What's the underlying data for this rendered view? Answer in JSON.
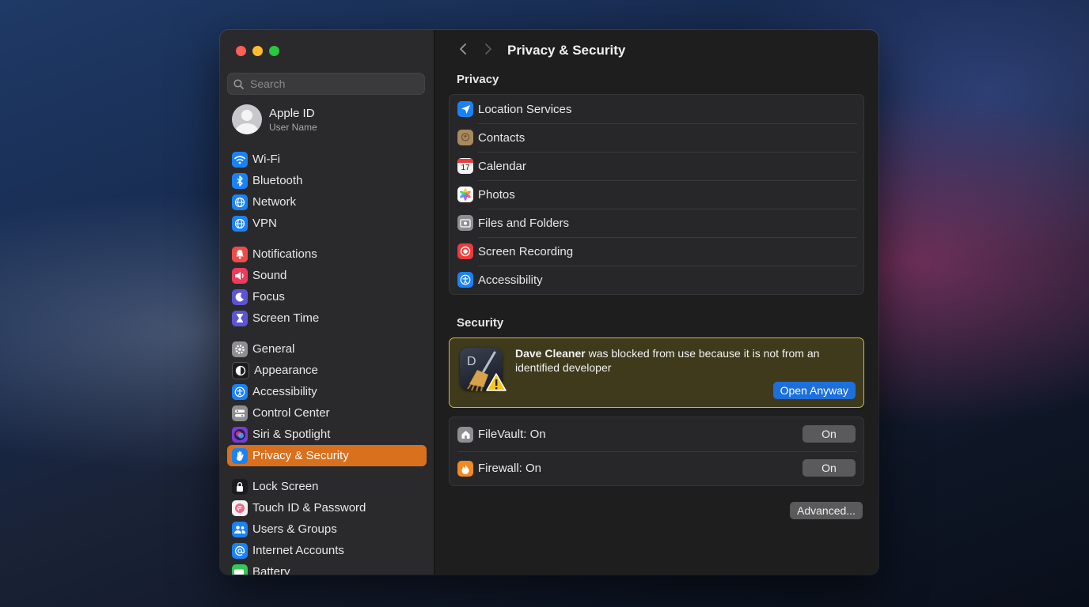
{
  "sidebar": {
    "search_placeholder": "Search",
    "apple_id": {
      "name": "Apple ID",
      "subtitle": "User Name"
    },
    "groups": [
      [
        {
          "label": "Wi-Fi",
          "icon": "wifi-icon",
          "color": "#1a82f7"
        },
        {
          "label": "Bluetooth",
          "icon": "bluetooth-icon",
          "color": "#1a82f7"
        },
        {
          "label": "Network",
          "icon": "globe-icon",
          "color": "#1a82f7"
        },
        {
          "label": "VPN",
          "icon": "globe-icon",
          "color": "#1a82f7"
        }
      ],
      [
        {
          "label": "Notifications",
          "icon": "bell-icon",
          "color": "#ee4b4b"
        },
        {
          "label": "Sound",
          "icon": "speaker-icon",
          "color": "#ee3b5b"
        },
        {
          "label": "Focus",
          "icon": "moon-icon",
          "color": "#5b55d6"
        },
        {
          "label": "Screen Time",
          "icon": "hourglass-icon",
          "color": "#5b55d6"
        }
      ],
      [
        {
          "label": "General",
          "icon": "gear-icon",
          "color": "#8e8e93"
        },
        {
          "label": "Appearance",
          "icon": "appearance-icon",
          "color": "#1c1c1e"
        },
        {
          "label": "Accessibility",
          "icon": "accessibility-icon",
          "color": "#1a82f7"
        },
        {
          "label": "Control Center",
          "icon": "switches-icon",
          "color": "#8e8e93"
        },
        {
          "label": "Siri & Spotlight",
          "icon": "siri-icon",
          "color": "#7a3bd6"
        },
        {
          "label": "Privacy & Security",
          "icon": "hand-icon",
          "color": "#1a82f7",
          "active": true
        }
      ],
      [
        {
          "label": "Lock Screen",
          "icon": "lock-icon",
          "color": "#1c1c1e"
        },
        {
          "label": "Touch ID & Password",
          "icon": "fingerprint-icon",
          "color": "#f2f2f2"
        },
        {
          "label": "Users & Groups",
          "icon": "users-icon",
          "color": "#1a82f7"
        },
        {
          "label": "Internet Accounts",
          "icon": "at-icon",
          "color": "#1a82f7"
        },
        {
          "label": "Battery",
          "icon": "battery-icon",
          "color": "#34c759"
        }
      ]
    ]
  },
  "main": {
    "title": "Privacy & Security",
    "privacy_heading": "Privacy",
    "privacy_items": [
      {
        "label": "Location Services",
        "icon": "location-arrow-icon",
        "color": "#1a82f7"
      },
      {
        "label": "Contacts",
        "icon": "contacts-icon",
        "color": "#a98a5e"
      },
      {
        "label": "Calendar",
        "icon": "calendar-icon",
        "color": "#f2f2f2",
        "glyph": "17"
      },
      {
        "label": "Photos",
        "icon": "photos-icon",
        "color": "#ffffff"
      },
      {
        "label": "Files and Folders",
        "icon": "folder-icon",
        "color": "#8e8e93"
      },
      {
        "label": "Screen Recording",
        "icon": "record-icon",
        "color": "#ee3b3b"
      },
      {
        "label": "Accessibility",
        "icon": "accessibility-icon",
        "color": "#1a82f7"
      }
    ],
    "security_heading": "Security",
    "alert": {
      "app_name": "Dave Cleaner",
      "message": " was blocked from use because it is not from an identified developer",
      "button": "Open Anyway",
      "app_letter": "D"
    },
    "security_items": [
      {
        "label": "FileVault: On",
        "button": "On",
        "icon": "house-icon",
        "color": "#8e8e93"
      },
      {
        "label": "Firewall: On",
        "button": "On",
        "icon": "flame-icon",
        "color": "#f08a24"
      }
    ],
    "advanced_button": "Advanced..."
  }
}
